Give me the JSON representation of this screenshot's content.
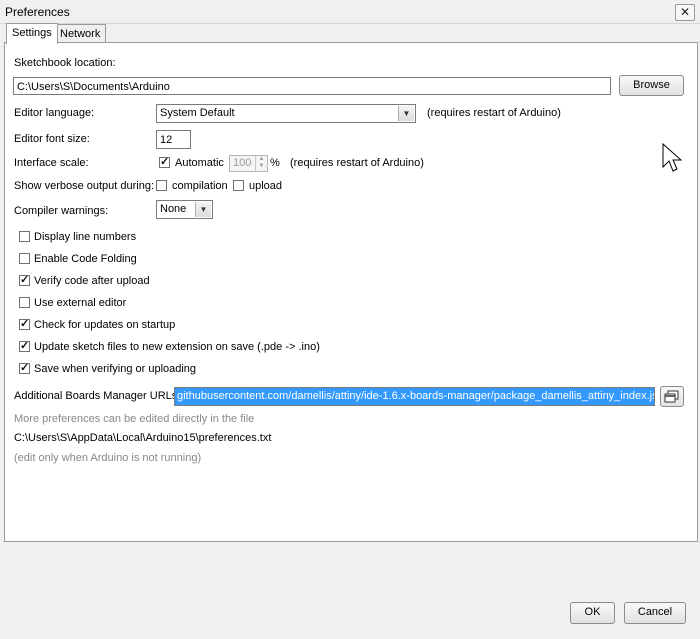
{
  "window": {
    "title": "Preferences",
    "close_symbol": "✕"
  },
  "tabs": [
    {
      "label": "Settings"
    },
    {
      "label": "Network"
    }
  ],
  "settings": {
    "sketchbook_label": "Sketchbook location:",
    "sketchbook_value": "C:\\Users\\S\\Documents\\Arduino",
    "browse_label": "Browse",
    "editor_language_label": "Editor language:",
    "editor_language_value": "System Default",
    "editor_language_note": "(requires restart of Arduino)",
    "font_size_label": "Editor font size:",
    "font_size_value": "12",
    "interface_scale_label": "Interface scale:",
    "automatic_label": "Automatic",
    "automatic_checked": true,
    "scale_value": "100",
    "scale_unit": "%",
    "scale_note": "(requires restart of Arduino)",
    "verbose_label": "Show verbose output during:",
    "compilation_label": "compilation",
    "upload_label": "upload",
    "compiler_warnings_label": "Compiler warnings:",
    "compiler_warnings_value": "None",
    "options": [
      {
        "label": "Display line numbers",
        "checked": false
      },
      {
        "label": "Enable Code Folding",
        "checked": false
      },
      {
        "label": "Verify code after upload",
        "checked": true
      },
      {
        "label": "Use external editor",
        "checked": false
      },
      {
        "label": "Check for updates on startup",
        "checked": true
      },
      {
        "label": "Update sketch files to new extension on save (.pde -> .ino)",
        "checked": true
      },
      {
        "label": "Save when verifying or uploading",
        "checked": true
      }
    ],
    "boards_url_label": "Additional Boards Manager URLs:",
    "boards_url_value": "githubusercontent.com/damellis/attiny/ide-1.6.x-boards-manager/package_damellis_attiny_index.json",
    "more_prefs_note": "More preferences can be edited directly in the file",
    "prefs_path": "C:\\Users\\S\\AppData\\Local\\Arduino15\\preferences.txt",
    "edit_note": "(edit only when Arduino is not running)"
  },
  "footer": {
    "ok_label": "OK",
    "cancel_label": "Cancel"
  },
  "colors": {
    "selection": "#3399ff"
  }
}
